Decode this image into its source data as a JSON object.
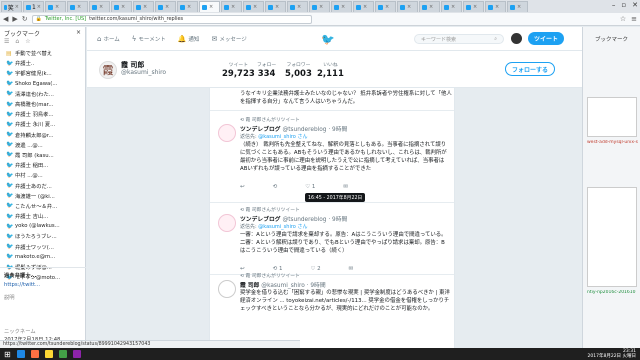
{
  "browser": {
    "tabs": [
      {
        "label": "笑",
        "active": false
      },
      {
        "label": "1",
        "active": false
      },
      {
        "label": "",
        "active": false
      },
      {
        "label": "",
        "active": false
      },
      {
        "label": "",
        "active": false
      },
      {
        "label": "",
        "active": false
      },
      {
        "label": "",
        "active": false
      },
      {
        "label": "",
        "active": false
      },
      {
        "label": "",
        "active": false
      },
      {
        "label": "",
        "active": true
      },
      {
        "label": "",
        "active": false
      },
      {
        "label": "",
        "active": false
      },
      {
        "label": "",
        "active": false
      },
      {
        "label": "",
        "active": false
      },
      {
        "label": "",
        "active": false
      },
      {
        "label": "",
        "active": false
      },
      {
        "label": "",
        "active": false
      },
      {
        "label": "",
        "active": false
      },
      {
        "label": "",
        "active": false
      },
      {
        "label": "",
        "active": false
      },
      {
        "label": "",
        "active": false
      },
      {
        "label": "",
        "active": false
      },
      {
        "label": "",
        "active": false
      },
      {
        "label": "",
        "active": false
      }
    ],
    "ev_label": "Twitter, Inc. [US]",
    "url": "twitter.com/kasumi_shiro/with_replies"
  },
  "sidebar": {
    "title": "ブックマーク",
    "close": "×",
    "items": [
      {
        "label": "手動で並べ替え",
        "type": "folder"
      },
      {
        "label": "弁護士..",
        "type": "bird"
      },
      {
        "label": "宇都宮健児(k...",
        "type": "bird"
      },
      {
        "label": "Shoko Egawa(...",
        "type": "bird"
      },
      {
        "label": "清澤達也(わた...",
        "type": "bird"
      },
      {
        "label": "高橋雅也(mar...",
        "type": "bird"
      },
      {
        "label": "弁護士 羽鳥孝...",
        "type": "bird"
      },
      {
        "label": "弁護士 永川 夏...",
        "type": "bird"
      },
      {
        "label": "倉持麟太郎@r...",
        "type": "bird"
      },
      {
        "label": "渡邊 ...@...",
        "type": "bird"
      },
      {
        "label": "霞 司郎 (kasu...",
        "type": "bird"
      },
      {
        "label": "弁護士 稲田...",
        "type": "bird"
      },
      {
        "label": "中村 ...@...",
        "type": "bird"
      },
      {
        "label": "弁護士あのだ...",
        "type": "bird"
      },
      {
        "label": "海渡雄一 (@ki...",
        "type": "bird"
      },
      {
        "label": "こたんせ〜＆弁...",
        "type": "bird"
      },
      {
        "label": "弁護士 吉山...",
        "type": "bird"
      },
      {
        "label": "yoko (@lawkus...",
        "type": "bird"
      },
      {
        "label": "ほうたろうブレ...",
        "type": "bird"
      },
      {
        "label": "弁護士ワッツ(...",
        "type": "bird"
      },
      {
        "label": "makoto.e@m...",
        "type": "bird"
      },
      {
        "label": "堀髪みずぼ@...",
        "type": "bird"
      },
      {
        "label": "モトケン@moto...",
        "type": "bird"
      }
    ],
    "detail": {
      "title": "過食弁護士...",
      "url": "https://twitt...",
      "label": "説明",
      "date_label": "ニックネーム",
      "date": "2017年2月18日 12:48"
    }
  },
  "twitter": {
    "nav": [
      {
        "icon": "⌂",
        "label": "ホーム"
      },
      {
        "icon": "ϟ",
        "label": "モーメント"
      },
      {
        "icon": "🔔",
        "label": "通知"
      },
      {
        "icon": "✉",
        "label": "メッセージ"
      }
    ],
    "search_placeholder": "キーワード検索",
    "tweet_button": "ツイート",
    "profile": {
      "name": "霞 司郎",
      "handle": "@kasumi_shiro",
      "avatar_glyph": "霞",
      "stats": [
        {
          "label": "ツイート",
          "value": "29,723"
        },
        {
          "label": "フォロー",
          "value": "334"
        },
        {
          "label": "フォロワー",
          "value": "5,003"
        },
        {
          "label": "いいね",
          "value": "2,111"
        }
      ],
      "follow_label": "フォローする"
    },
    "tweets": [
      {
        "text": "うなイキリ企業法務弁護士みたいなのじゃない？ 抵弁系訴者や労住権系に対して「他人を指揮する自分」なんて言う人はいちゃうんだ。"
      },
      {
        "rt": "霞 司郎さんがリツイート",
        "name": "ツンデレブログ",
        "handle": "@tsundereblog",
        "time": "9時間",
        "reply_prefix": "返信先:",
        "reply_to": "@kasumi_shiro さん",
        "text": "（続き） 裁判所も先全整えてねな、解釈の見落としもある。当事者に指摘されて誤りに気づくこともある。ABもそういう理由であるかもしれないし、これらは、裁判所が最初から当事者に事前に理由を説明したうえで公に指摘して考えていれば、当事者はABいずれもが誤っている理由を指摘することができた",
        "actions": [
          "↩",
          "⟲",
          "♡ 1",
          "✉"
        ],
        "tooltip": "16:45 - 2017年8月22日"
      },
      {
        "rt": "霞 司郎さんがリツイート",
        "name": "ツンデレブログ",
        "handle": "@tsundereblog",
        "time": "9時間",
        "reply_prefix": "返信先:",
        "reply_to": "@kasumi_shiro さん",
        "text": "一審：Aという理由で請求を棄却する。原告：Aはこうこういう理由で間違っている。二審：Aという解釈は誤りであり、でもBという理由でやっぱり請求は棄却。原告：Bはこうこういう理由で間違っている（続く）",
        "actions": [
          "↩",
          "⟲ 1",
          "♡ 2",
          "✉"
        ]
      },
      {
        "rt": "霞 司郎さんがリツイート",
        "name": "霞 司郎",
        "handle": "@kasumi_shiro",
        "time": "9時間",
        "text": "奨学金を借りる込む「困窮する親」の悲惨な現実 | 奨学金制度はどうあるべきか | 東洋経済オンライン ... toyokeizai.net/articles/-/113... 奨学金の借金を借権をしっかりチェックすべきということなら分かるが、現実的にどれだけのことが可能なのか。"
      }
    ]
  },
  "right_pane": {
    "title": "ブックマーク",
    "link1": "west-add-mysql-unix-s",
    "link2": "ntiy-np2016c-201610"
  },
  "statusbar": "https://twitter.com/tsundereblog/status/89991042943157043",
  "clock": {
    "time": "23:31",
    "date": "2017年8月22日 火曜日"
  }
}
